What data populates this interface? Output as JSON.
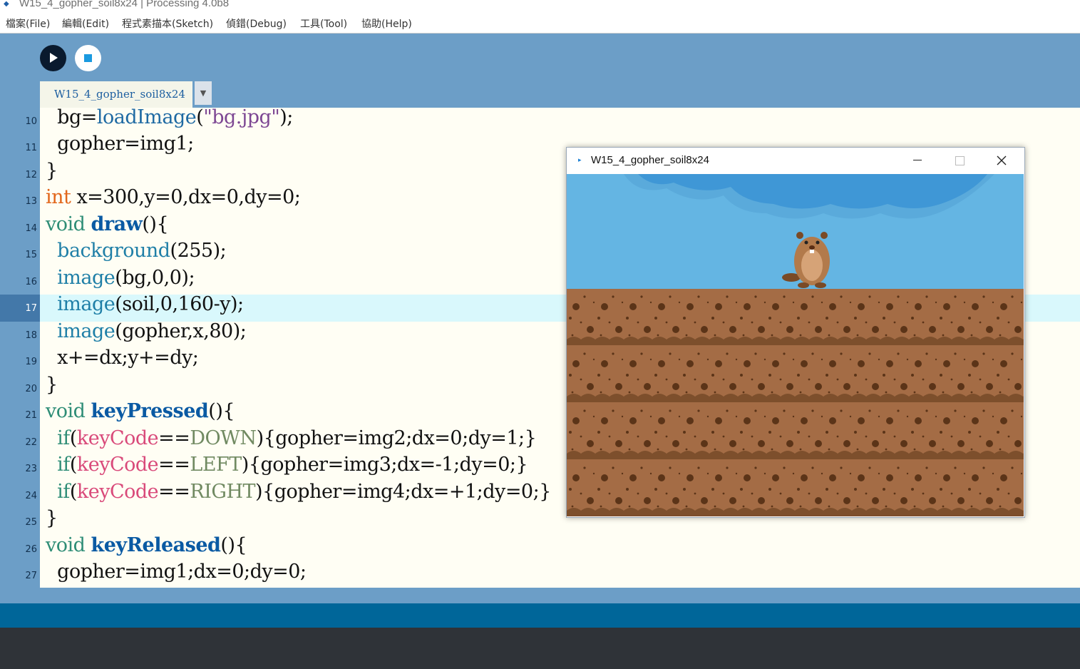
{
  "window": {
    "title": "W15_4_gopher_soil8x24 | Processing 4.0b8"
  },
  "menu": {
    "file": "檔案(File)",
    "edit": "編輯(Edit)",
    "sketch": "程式素描本(Sketch)",
    "debug": "偵錯(Debug)",
    "tool": "工具(Tool)",
    "help": "協助(Help)"
  },
  "toolbar": {
    "run_icon": "play-icon",
    "stop_icon": "stop-icon"
  },
  "tab": {
    "label": "W15_4_gopher_soil8x24",
    "menu_icon": "chevron-down-icon"
  },
  "editor": {
    "current_line": 17,
    "lines": [
      {
        "n": "10",
        "text": "  bg=loadImage(\"bg.jpg\");"
      },
      {
        "n": "11",
        "text": "  gopher=img1;"
      },
      {
        "n": "12",
        "text": "}"
      },
      {
        "n": "13",
        "text": "int x=300,y=0,dx=0,dy=0;"
      },
      {
        "n": "14",
        "text": "void draw(){"
      },
      {
        "n": "15",
        "text": "  background(255);"
      },
      {
        "n": "16",
        "text": "  image(bg,0,0);"
      },
      {
        "n": "17",
        "text": "  image(soil,0,160-y);"
      },
      {
        "n": "18",
        "text": "  image(gopher,x,80);"
      },
      {
        "n": "19",
        "text": "  x+=dx;y+=dy;"
      },
      {
        "n": "20",
        "text": "}"
      },
      {
        "n": "21",
        "text": "void keyPressed(){"
      },
      {
        "n": "22",
        "text": "  if(keyCode==DOWN){gopher=img2;dx=0;dy=1;}"
      },
      {
        "n": "23",
        "text": "  if(keyCode==LEFT){gopher=img3;dx=-1;dy=0;}"
      },
      {
        "n": "24",
        "text": "  if(keyCode==RIGHT){gopher=img4;dx=+1;dy=0;}"
      },
      {
        "n": "25",
        "text": "}"
      },
      {
        "n": "26",
        "text": "void keyReleased(){"
      },
      {
        "n": "27",
        "text": "  gopher=img1;dx=0;dy=0;"
      }
    ]
  },
  "sketch_window": {
    "title": "W15_4_gopher_soil8x24",
    "minimize_icon": "minimize-icon",
    "maximize_icon": "maximize-icon",
    "close_icon": "close-icon"
  },
  "colors": {
    "toolbar_bg": "#6c9ec7",
    "editor_bg": "#fffef4",
    "current_line_bg": "#d9f8fc",
    "status_bar": "#006699",
    "console_bg": "#2f3338",
    "sky": "#64b5e3",
    "soil": "#a46c45"
  }
}
